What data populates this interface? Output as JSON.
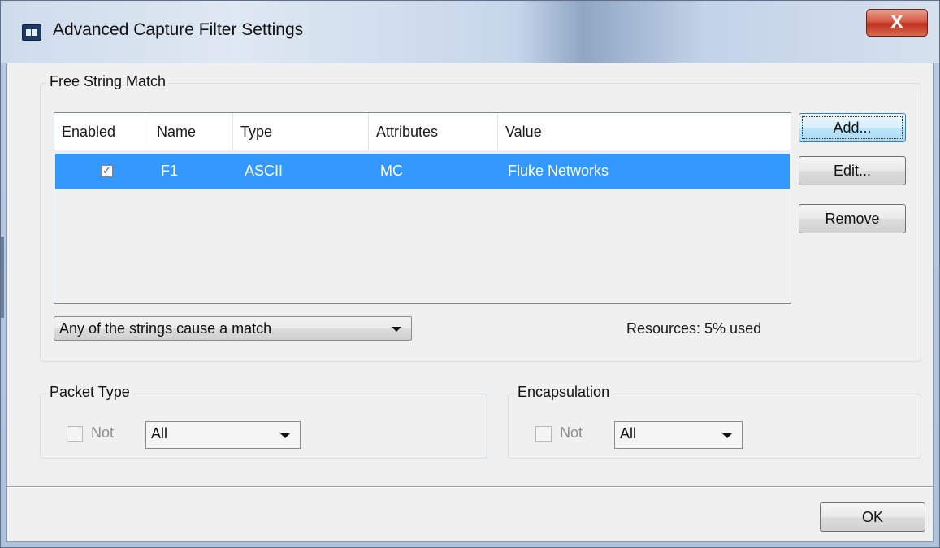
{
  "window": {
    "title": "Advanced Capture Filter Settings",
    "close_label": "X"
  },
  "free_string_match": {
    "group_label": "Free String Match",
    "columns": [
      "Enabled",
      "Name",
      "Type",
      "Attributes",
      "Value"
    ],
    "rows": [
      {
        "enabled": true,
        "enabled_mark": "✓",
        "name": "F1",
        "type": "ASCII",
        "attributes": "MC",
        "value": "Fluke Networks"
      }
    ],
    "buttons": {
      "add": "Add...",
      "edit": "Edit...",
      "remove": "Remove"
    },
    "match_mode": "Any of the strings cause a match",
    "resources": "Resources: 5% used"
  },
  "packet_type": {
    "group_label": "Packet Type",
    "not_label": "Not",
    "value": "All"
  },
  "encapsulation": {
    "group_label": "Encapsulation",
    "not_label": "Not",
    "value": "All"
  },
  "footer": {
    "ok_label": "OK"
  },
  "colors": {
    "selection": "#3399ff",
    "close_button": "#c2321f"
  }
}
